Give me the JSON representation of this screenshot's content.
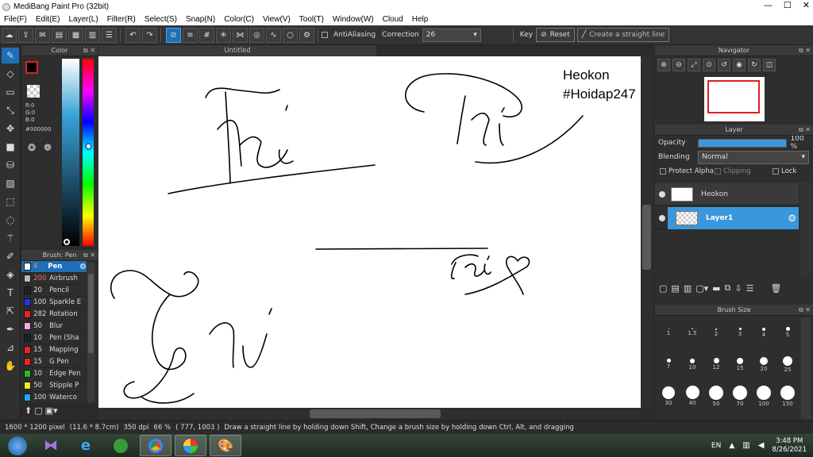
{
  "window": {
    "title": "MediBang Paint Pro (32bit)"
  },
  "menu": [
    "File(F)",
    "Edit(E)",
    "Layer(L)",
    "Filter(R)",
    "Select(S)",
    "Snap(N)",
    "Color(C)",
    "View(V)",
    "Tool(T)",
    "Window(W)",
    "Cloud",
    "Help"
  ],
  "toolbar": {
    "antialiasing_label": "AntiAliasing",
    "correction_label": "Correction",
    "correction_value": "26",
    "key_label": "Key",
    "reset_label": "Reset",
    "straight_line_label": "Create a straight line"
  },
  "color_panel": {
    "title": "Color",
    "r": "R:0",
    "g": "G:0",
    "b": "B:0",
    "hex": "#000000"
  },
  "brush_panel": {
    "title": "Brush: Pen",
    "items": [
      {
        "size": "4",
        "name": "Pen",
        "color": "#1e6fb8",
        "selected": true
      },
      {
        "size": "200",
        "name": "Airbrush",
        "color": "#bbbbbb"
      },
      {
        "size": "20",
        "name": "Pencil",
        "color": "#222222"
      },
      {
        "size": "100",
        "name": "Sparkle E",
        "color": "#2233ee"
      },
      {
        "size": "282",
        "name": "Rotation",
        "color": "#ee2222"
      },
      {
        "size": "50",
        "name": "Blur",
        "color": "#f6a6e6"
      },
      {
        "size": "10",
        "name": "Pen (Sha",
        "color": "#222222"
      },
      {
        "size": "15",
        "name": "Mapping",
        "color": "#ee2222"
      },
      {
        "size": "15",
        "name": "G Pen",
        "color": "#ee2222"
      },
      {
        "size": "10",
        "name": "Edge Pen",
        "color": "#22bb22"
      },
      {
        "size": "50",
        "name": "Stipple P",
        "color": "#eeee22"
      },
      {
        "size": "100",
        "name": "Waterco",
        "color": "#22aaee"
      }
    ]
  },
  "document": {
    "tab_title": "Untitled"
  },
  "canvas_text": {
    "line1": "Heokon",
    "line2": "#Hoidap247"
  },
  "navigator": {
    "title": "Navigator"
  },
  "layer_panel": {
    "title": "Layer",
    "opacity_label": "Opacity",
    "opacity_value": "100 %",
    "opacity_fraction": 1.0,
    "blending_label": "Blending",
    "blending_value": "Normal",
    "protect_alpha": "Protect Alpha",
    "clipping": "Clipping",
    "lock": "Lock",
    "layers": [
      {
        "name": "Heokon",
        "selected": false
      },
      {
        "name": "Layer1",
        "selected": true
      }
    ]
  },
  "brush_size_panel": {
    "title": "Brush Size",
    "row1": [
      "1",
      "1.5",
      "2",
      "3",
      "4",
      "5"
    ],
    "row2": [
      "7",
      "10",
      "12",
      "15",
      "20",
      "25"
    ],
    "row3": [
      "30",
      "40",
      "50",
      "70",
      "100",
      "150"
    ]
  },
  "status": {
    "dimensions": "1600 * 1200 pixel",
    "physical": "(11.6 * 8.7cm)",
    "dpi": "350 dpi",
    "zoom": "66 %",
    "coords": "( 777, 1003 )",
    "hint": "Draw a straight line by holding down Shift, Change a brush size by holding down Ctrl, Alt, and dragging"
  },
  "taskbar": {
    "lang": "EN",
    "time": "3:48 PM",
    "date": "8/26/2021"
  },
  "colors": {
    "accent": "#1e6fb8",
    "panel_bg": "#2e2e2e",
    "canvas_bg": "#ffffff"
  }
}
